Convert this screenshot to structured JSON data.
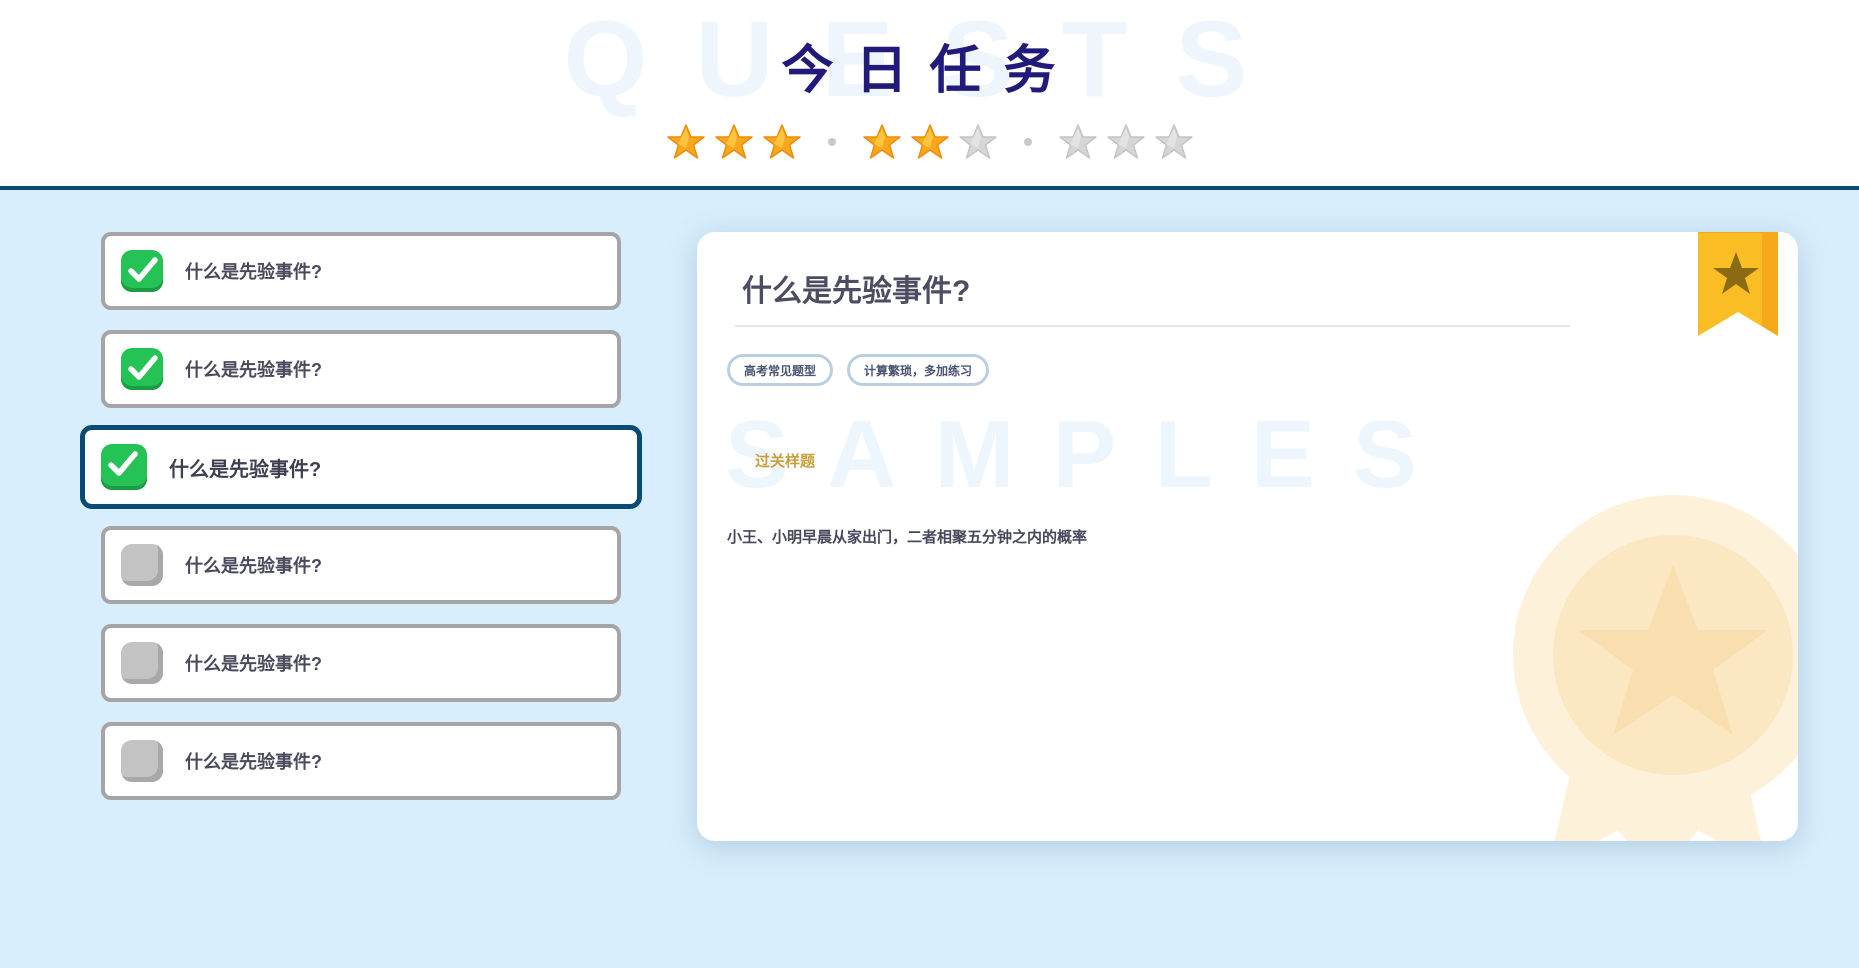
{
  "header": {
    "watermark": "QUESTS",
    "title": "今日任务",
    "star_groups": [
      {
        "filled": 3,
        "total": 3
      },
      {
        "filled": 2,
        "total": 3
      },
      {
        "filled": 0,
        "total": 3
      }
    ]
  },
  "quests": [
    {
      "label": "什么是先验事件?",
      "status": "completed"
    },
    {
      "label": "什么是先验事件?",
      "status": "completed"
    },
    {
      "label": "什么是先验事件?",
      "status": "completed",
      "selected": true
    },
    {
      "label": "什么是先验事件?",
      "status": "locked"
    },
    {
      "label": "什么是先验事件?",
      "status": "locked"
    },
    {
      "label": "什么是先验事件?",
      "status": "locked"
    }
  ],
  "detail": {
    "watermark": "SAMPLES",
    "title": "什么是先验事件?",
    "tags": [
      "高考常见题型",
      "计算繁琐，多加练习"
    ],
    "section_label": "过关样题",
    "question": "小王、小明早晨从家出门，二者相聚五分钟之内的概率"
  },
  "colors": {
    "header_rule": "#0b4a74",
    "background": "#d8eefc",
    "title": "#221a7a",
    "star_filled": "#f7a81b",
    "star_empty": "#d6d6d6",
    "check_green": "#25c256",
    "section_label": "#caa03e",
    "bookmark": "#fbbd24"
  },
  "icons": {
    "star": "star-icon",
    "check": "check-icon",
    "locked": "locked-task-icon",
    "bookmark": "bookmark-star-icon",
    "badge": "award-badge-icon"
  }
}
